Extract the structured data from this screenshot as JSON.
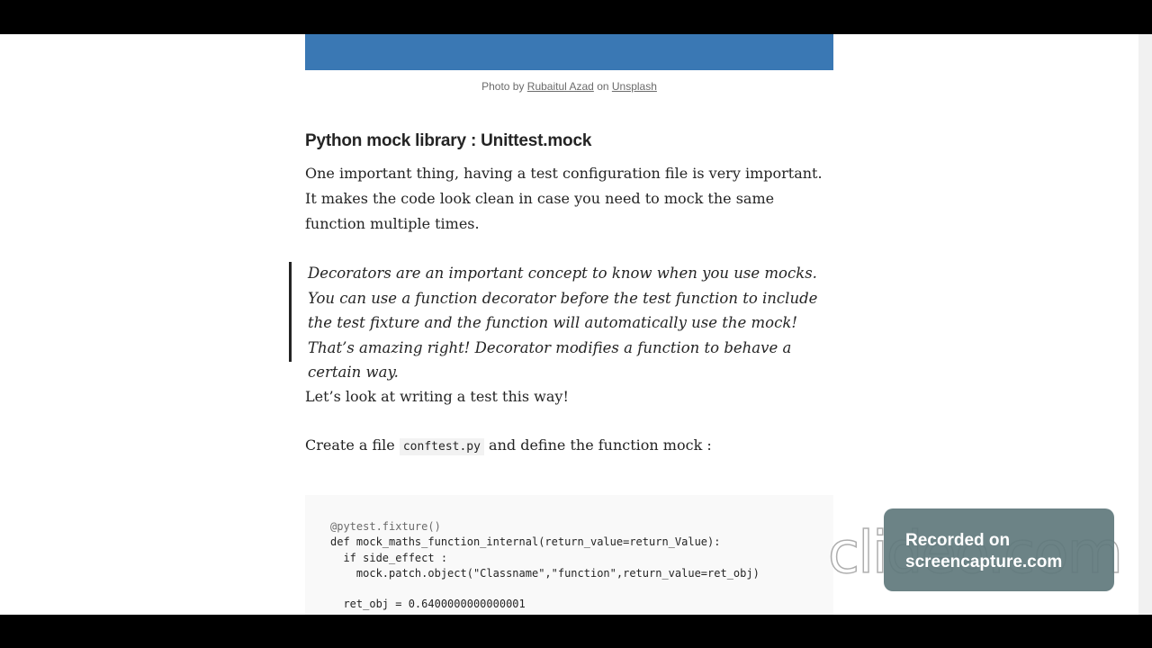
{
  "caption": {
    "prefix": "Photo by ",
    "author": "Rubaitul Azad",
    "middle": " on ",
    "source": "Unsplash"
  },
  "article": {
    "heading": "Python mock library : Unittest.mock",
    "para1": "One important thing, having a test configuration file is very important. It makes the code look clean in case you need to mock the same function multiple times.",
    "quote": "Decorators are an important concept to know when you use mocks. You can use a function decorator before the test function to include the test fixture and the function will automatically use the mock! That’s amazing right! Decorator modifies a function to behave a certain way.",
    "para2": "Let’s look at writing a test this way!",
    "para3_prefix": "Create a file ",
    "para3_code": "conftest.py",
    "para3_suffix": " and define the function mock :"
  },
  "code": {
    "line1": "@pytest.fixture()",
    "line2": "def mock_maths_function_internal(return_value=return_Value):",
    "line3": "  if side_effect :",
    "line4": "    mock.patch.object(\"Classname\",\"function\",return_value=ret_obj)",
    "line5": "",
    "line6": "  ret_obj = 0.6400000000000001"
  },
  "overlay": {
    "recorded_line1": "Recorded on",
    "recorded_line2": "screencapture.com",
    "watermark": "clideo.com"
  }
}
